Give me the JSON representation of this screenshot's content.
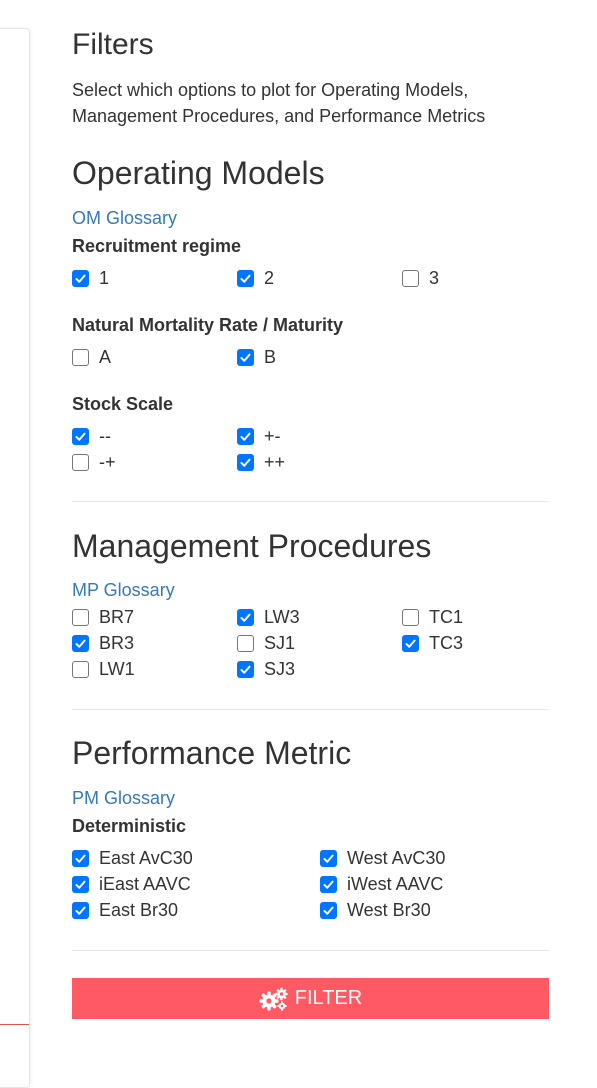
{
  "header": {
    "title": "Filters",
    "description": "Select which options to plot for Operating Models, Management Procedures, and Performance Metrics"
  },
  "om": {
    "title": "Operating Models",
    "glossary": "OM Glossary",
    "groups": [
      {
        "label": "Recruitment regime",
        "options": [
          {
            "label": "1",
            "checked": true
          },
          {
            "label": "2",
            "checked": true
          },
          {
            "label": "3",
            "checked": false
          }
        ]
      },
      {
        "label": "Natural Mortality Rate / Maturity",
        "options": [
          {
            "label": "A",
            "checked": false
          },
          {
            "label": "B",
            "checked": true
          }
        ]
      },
      {
        "label": "Stock Scale",
        "options": [
          {
            "label": "--",
            "checked": true
          },
          {
            "label": "+-",
            "checked": true
          },
          {
            "label": "-+",
            "checked": false
          },
          {
            "label": "++",
            "checked": true
          }
        ]
      }
    ]
  },
  "mp": {
    "title": "Management Procedures",
    "glossary": "MP Glossary",
    "options": [
      {
        "label": "BR7",
        "checked": false
      },
      {
        "label": "LW3",
        "checked": true
      },
      {
        "label": "TC1",
        "checked": false
      },
      {
        "label": "BR3",
        "checked": true
      },
      {
        "label": "SJ1",
        "checked": false
      },
      {
        "label": "TC3",
        "checked": true
      },
      {
        "label": "LW1",
        "checked": false
      },
      {
        "label": "SJ3",
        "checked": true
      }
    ]
  },
  "pm": {
    "title": "Performance Metric",
    "glossary": "PM Glossary",
    "group_label": "Deterministic",
    "options": [
      {
        "label": "East AvC30",
        "checked": true
      },
      {
        "label": "West AvC30",
        "checked": true
      },
      {
        "label": "iEast AAVC",
        "checked": true
      },
      {
        "label": "iWest AAVC",
        "checked": true
      },
      {
        "label": "East Br30",
        "checked": true
      },
      {
        "label": "West Br30",
        "checked": true
      }
    ]
  },
  "filter_button": {
    "label": "FILTER",
    "icon": "cogs-icon"
  },
  "colors": {
    "accent_button": "#ff5a64",
    "link": "#337ab7",
    "checkbox": "#0075ff"
  }
}
